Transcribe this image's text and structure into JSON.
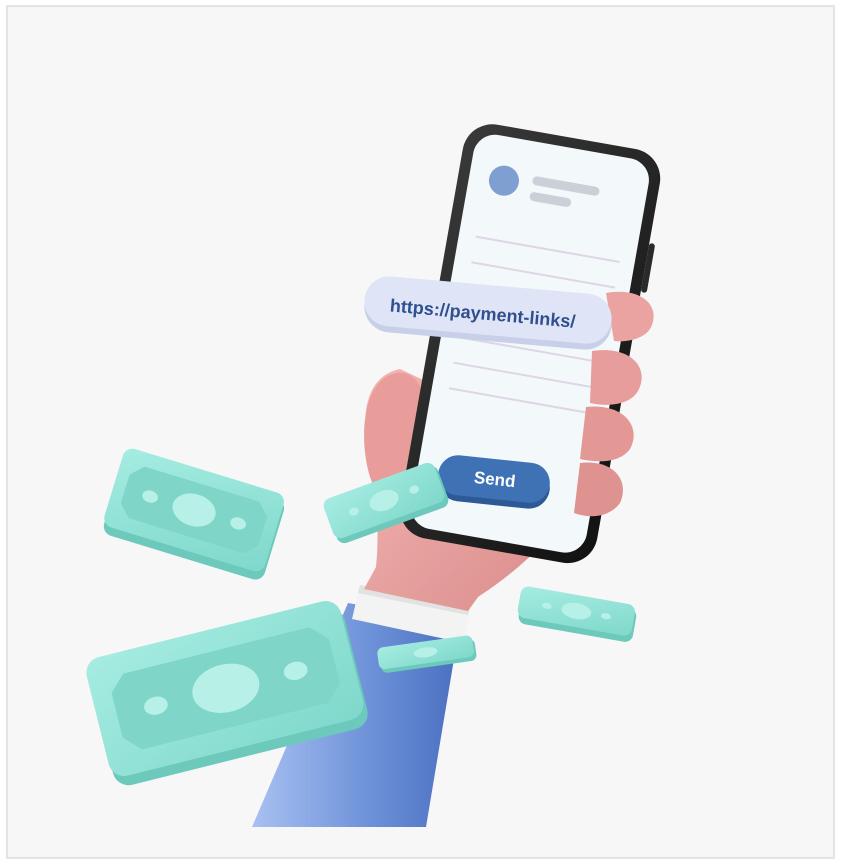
{
  "illustration": {
    "url_pill": {
      "text": "https://payment-links/"
    },
    "send_button": {
      "label": "Send"
    },
    "colors": {
      "background": "#f7f7f7",
      "border": "#e4e4e4",
      "phone_body": "#1f1f1f",
      "phone_screen": "#f3f8fb",
      "avatar": "#7e9fcf",
      "url_pill": "#dfe5f7",
      "url_text": "#2f4f8f",
      "send_button": "#3f72b5",
      "hand": "#eaa3a1",
      "sleeve": "#6f93d9",
      "cuff": "#f3f3f3",
      "banknote": "#8fe3d6"
    }
  }
}
